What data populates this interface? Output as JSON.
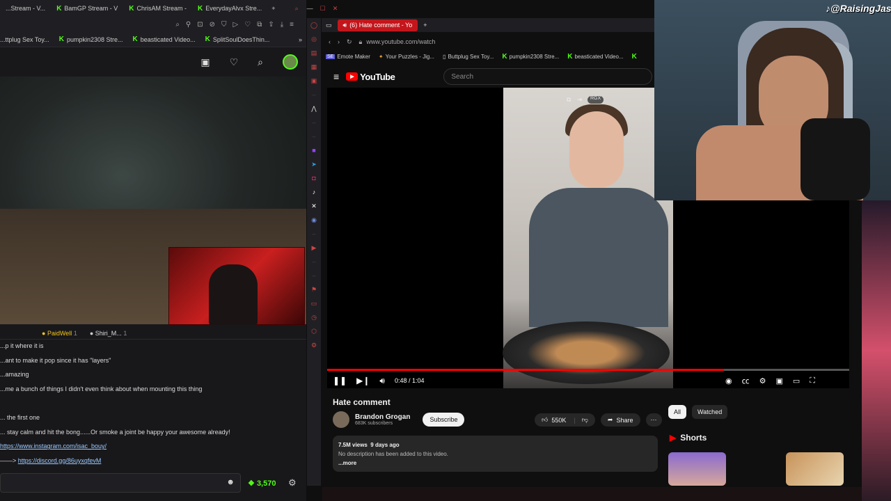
{
  "left_browser": {
    "tabs": [
      {
        "label": "...Stream - V..."
      },
      {
        "label": "BamGP Stream - V"
      },
      {
        "label": "ChrisAM Stream -"
      },
      {
        "label": "EverydayAlvx Stre..."
      }
    ],
    "bookmarks": [
      "...ttplug Sex Toy...",
      "pumpkin2308 Stre...",
      "beasticated Video...",
      "SplitSoulDoesThin..."
    ],
    "chat_header": {
      "user1": "PaidWell",
      "user1_count": "1",
      "user2": "Shiri_M...",
      "user2_count": "1"
    },
    "chat_lines": [
      {
        "text": "...p it where it is"
      },
      {
        "text": "...ant to make it pop since it has \"layers\""
      },
      {
        "text": "...amazing"
      },
      {
        "text": "...me a bunch of things I didn't even think about when mounting this thing"
      },
      {
        "text": ""
      },
      {
        "text": "... the first one"
      },
      {
        "text": "... stay calm and hit the bong......Or smoke a joint be happy your awesome already!"
      },
      {
        "text": "https://www.instagram.com/isac_bouy/",
        "link": true
      },
      {
        "text": "https://discord.gg/86uyxqfevM",
        "prefix": "——>",
        "link": true
      }
    ],
    "points": "3,570"
  },
  "right_browser": {
    "tab_title": "(6) Hate comment - Yo",
    "url": "www.youtube.com/watch",
    "bookmarks": [
      "Emote Maker",
      "Your Puzzles - Jig...",
      "Buttplug Sex Toy...",
      "pumpkin2308 Stre...",
      "beasticated Video..."
    ]
  },
  "youtube": {
    "logo": "YouTube",
    "search_placeholder": "Search",
    "player": {
      "current": "0:48",
      "duration": "1:04",
      "progress": 0.76,
      "time_display": "0:48 / 1:04"
    },
    "video_title": "Hate comment",
    "channel": {
      "name": "Brandon Grogan",
      "subs": "683K subscribers"
    },
    "subscribe_label": "Subscribe",
    "likes": "550K",
    "share_label": "Share",
    "description": {
      "views": "7.5M views",
      "age": "9 days ago",
      "text": "No description has been added to this video.",
      "more": "...more"
    },
    "chips": [
      "All",
      "Watched"
    ],
    "shorts_label": "Shorts"
  },
  "overlay": {
    "tiktok_handle": "@RaisingJas"
  },
  "colors": {
    "kick_green": "#53fc18",
    "youtube_red": "#ff0000",
    "tab_red": "#c3161c"
  }
}
